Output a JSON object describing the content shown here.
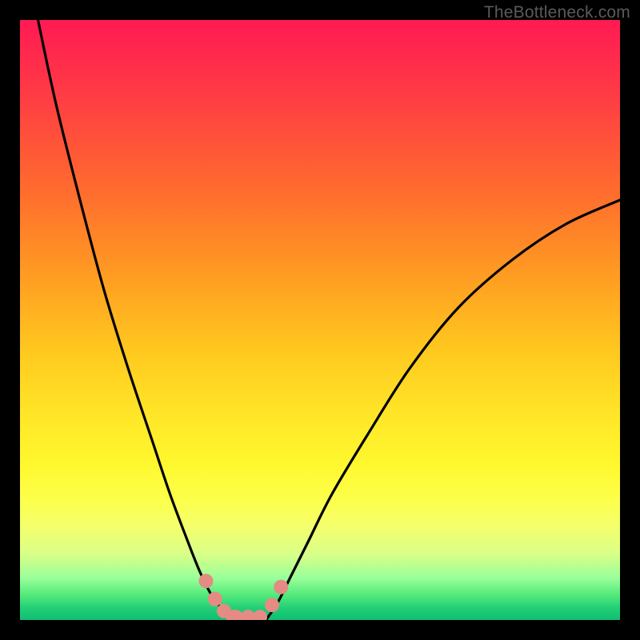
{
  "watermark": "TheBottleneck.com",
  "chart_data": {
    "type": "line",
    "title": "",
    "xlabel": "",
    "ylabel": "",
    "xlim": [
      0,
      100
    ],
    "ylim": [
      0,
      100
    ],
    "grid": false,
    "legend": false,
    "series": [
      {
        "name": "left-curve",
        "x": [
          3,
          6,
          10,
          14,
          18,
          22,
          25,
          28,
          30,
          32,
          33.5,
          35
        ],
        "y": [
          100,
          86,
          70,
          55,
          42,
          30,
          21,
          13,
          8,
          4,
          2,
          0
        ],
        "color": "#000000"
      },
      {
        "name": "right-curve",
        "x": [
          41,
          43,
          45,
          48,
          52,
          58,
          65,
          73,
          82,
          91,
          100
        ],
        "y": [
          0,
          3,
          7,
          13,
          21,
          31,
          42,
          52,
          60,
          66,
          70
        ],
        "color": "#000000"
      },
      {
        "name": "left-dots",
        "type": "scatter",
        "x": [
          31,
          32.5,
          34,
          35.5
        ],
        "y": [
          6.5,
          3.5,
          1.5,
          0.5
        ],
        "color": "#e48b84"
      },
      {
        "name": "bottom-dots",
        "type": "scatter",
        "x": [
          36,
          38,
          40
        ],
        "y": [
          0.5,
          0.5,
          0.5
        ],
        "color": "#e48b84"
      },
      {
        "name": "right-dots",
        "type": "scatter",
        "x": [
          42,
          43.5
        ],
        "y": [
          2.5,
          5.5
        ],
        "color": "#e48b84"
      }
    ],
    "background_gradient": {
      "top": "#ff1a53",
      "upper_mid": "#ff9a22",
      "mid": "#fff82e",
      "lower": "#4fe87a",
      "bottom": "#0fbf72"
    }
  }
}
